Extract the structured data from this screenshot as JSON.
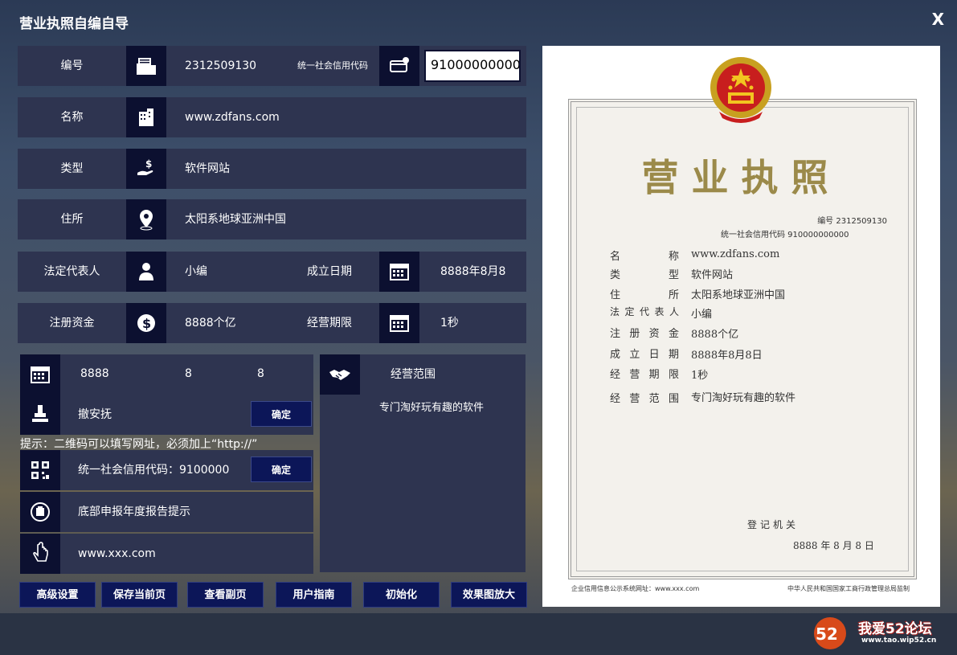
{
  "window": {
    "title": "营业执照自编自导",
    "close": "X"
  },
  "form": {
    "number": {
      "label": "编号",
      "value": "2312509130"
    },
    "credit_code": {
      "label": "统一社会信用代码",
      "value": "910000000000"
    },
    "name": {
      "label": "名称",
      "value": "www.zdfans.com"
    },
    "type": {
      "label": "类型",
      "value": "软件网站"
    },
    "address": {
      "label": "住所",
      "value": "太阳系地球亚洲中国"
    },
    "legal_rep": {
      "label": "法定代表人",
      "value": "小编"
    },
    "found_date": {
      "label": "成立日期",
      "value": "8888年8月8"
    },
    "capital": {
      "label": "注册资金",
      "value": "8888个亿"
    },
    "period": {
      "label": "经营期限",
      "value": "1秒"
    }
  },
  "date_row": {
    "year": "8888",
    "month": "8",
    "day": "8"
  },
  "stamp_row": {
    "label": "撤安抚",
    "button": "确定"
  },
  "hint": "提示：二维码可以填写网址，必须加上“http://”",
  "qr_row": {
    "label": "统一社会信用代码：9100000",
    "button": "确定"
  },
  "report_row": {
    "label": "底部申报年度报告提示"
  },
  "url_row": {
    "label": "www.xxx.com"
  },
  "scope": {
    "label": "经营范围",
    "value": "专门淘好玩有趣的软件"
  },
  "buttons": [
    "高级设置",
    "保存当前页",
    "查看副页",
    "用户指南",
    "初始化",
    "效果图放大"
  ],
  "certificate": {
    "title": "营业执照",
    "number_line": "编号 2312509130",
    "code_line": "统一社会信用代码 910000000000",
    "fields": [
      {
        "label": "名称",
        "value": "www.zdfans.com"
      },
      {
        "label": "类型",
        "value": "软件网站"
      },
      {
        "label": "住所",
        "value": "太阳系地球亚洲中国"
      },
      {
        "label": "法定代表人",
        "value": "小编"
      },
      {
        "label": "注册资金",
        "value": "8888个亿"
      },
      {
        "label": "成立日期",
        "value": "8888年8月8日"
      },
      {
        "label": "经营期限",
        "value": "1秒"
      },
      {
        "label": "经营范围",
        "value": "专门淘好玩有趣的软件"
      }
    ],
    "registrar": "登记机关",
    "reg_date": "8888 年 8 月 8 日",
    "footer_left": "企业信用信息公示系统网址：www.xxx.com",
    "footer_right": "中华人民共和国国家工商行政管理总局监制"
  },
  "watermark": {
    "text": "我爱52论坛",
    "url": "www.tao.wip52.cn"
  }
}
